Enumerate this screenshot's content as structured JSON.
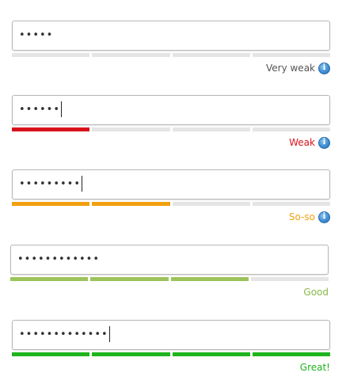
{
  "strength_examples": [
    {
      "password_masked": "•••••",
      "caret_visible": false,
      "filled_segments": 0,
      "total_segments": 4,
      "fill_color": "#e5e5e5",
      "empty_color": "#e5e5e5",
      "label": "Very weak",
      "label_color": "#555555",
      "info_icon": "info-icon",
      "info_icon_glyph": "i"
    },
    {
      "password_masked": "••••••",
      "caret_visible": true,
      "filled_segments": 1,
      "total_segments": 4,
      "fill_color": "#d9121a",
      "empty_color": "#e5e5e5",
      "label": "Weak",
      "label_color": "#d9121a",
      "info_icon": "info-icon",
      "info_icon_glyph": "i"
    },
    {
      "password_masked": "•••••••••",
      "caret_visible": true,
      "filled_segments": 2,
      "total_segments": 4,
      "fill_color": "#f2a00f",
      "empty_color": "#e5e5e5",
      "label": "So-so",
      "label_color": "#f2a00f",
      "info_icon": "info-icon",
      "info_icon_glyph": "i"
    },
    {
      "password_masked": "••••••••••••",
      "caret_visible": false,
      "filled_segments": 3,
      "total_segments": 4,
      "fill_color": "#9dc45a",
      "empty_color": "#e5e5e5",
      "label": "Good",
      "label_color": "#8ab84a",
      "info_icon": null,
      "info_icon_glyph": null
    },
    {
      "password_masked": "•••••••••••••",
      "caret_visible": true,
      "filled_segments": 4,
      "total_segments": 4,
      "fill_color": "#1fb41f",
      "empty_color": "#e5e5e5",
      "label": "Great!",
      "label_color": "#1fb41f",
      "info_icon": null,
      "info_icon_glyph": null
    }
  ]
}
